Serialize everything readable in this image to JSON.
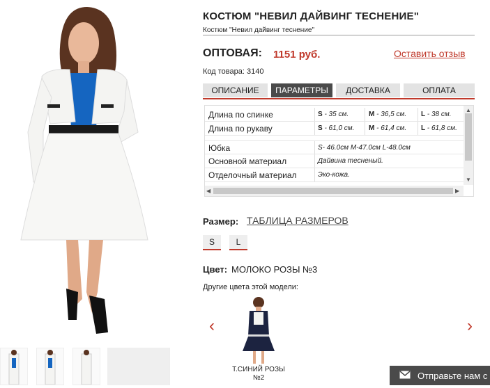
{
  "product": {
    "title": "КОСТЮМ \"НЕВИЛ ДАЙВИНГ ТЕСНЕНИЕ\"",
    "subtitle": "Костюм \"Невил дайвинг теснение\"",
    "price_label": "ОПТОВАЯ:",
    "price_value": "1151 руб.",
    "review_link": "Оставить отзыв",
    "sku": "Код товара: 3140"
  },
  "tabs": [
    {
      "label": "ОПИСАНИЕ"
    },
    {
      "label": "ПАРАМЕТРЫ"
    },
    {
      "label": "ДОСТАВКА"
    },
    {
      "label": "ОПЛАТА"
    }
  ],
  "params": [
    {
      "name": "Длина по спинке",
      "s": "S",
      "s_val": " - 35 см.",
      "m": "M",
      "m_val": " - 36,5 см.",
      "l": "L",
      "l_val": " - 38 см."
    },
    {
      "name": "Длина по рукаву",
      "s": "S",
      "s_val": " - 61,0 см.",
      "m": "M",
      "m_val": " - 61,4 см.",
      "l": "L",
      "l_val": " - 61,8 см."
    },
    {
      "name": "Юбка",
      "value": "S- 46.0см M-47.0см L-48.0см"
    },
    {
      "name": "Основной материал",
      "value": "Дайвина тесненый."
    },
    {
      "name": "Отделочный материал",
      "value": "Эко-кожа."
    }
  ],
  "size": {
    "label": "Размер:",
    "table_link": "ТАБЛИЦА РАЗМЕРОВ",
    "options": [
      "S",
      "L"
    ]
  },
  "color": {
    "label": "Цвет:",
    "value": "МОЛОКО РОЗЫ №3",
    "other_label": "Другие цвета этой модели:",
    "variant_caption_1": "Т.СИНИЙ РОЗЫ",
    "variant_caption_2": "№2"
  },
  "contact": {
    "label": "Отправьте нам с"
  },
  "colors": {
    "accent": "#c0392b",
    "tab_active": "#4a4a4a",
    "tab_inactive": "#e3e3e3"
  }
}
